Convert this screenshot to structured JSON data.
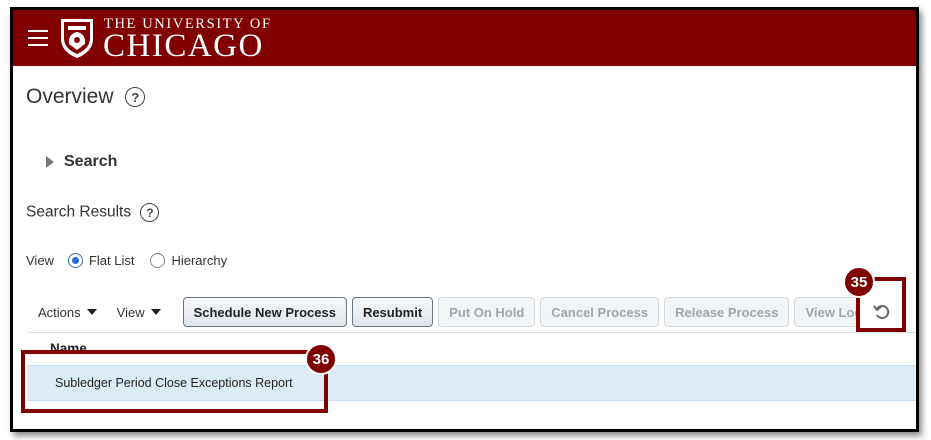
{
  "header": {
    "university_top": "THE UNIVERSITY OF",
    "university_main": "CHICAGO",
    "brand_color": "#800000"
  },
  "page": {
    "title": "Overview",
    "search_label": "Search",
    "search_results_label": "Search Results"
  },
  "view": {
    "label": "View",
    "options": [
      "Flat List",
      "Hierarchy"
    ],
    "selected": "Flat List"
  },
  "toolbar": {
    "actions_label": "Actions",
    "view_label": "View",
    "buttons": [
      {
        "label": "Schedule New Process",
        "enabled": true
      },
      {
        "label": "Resubmit",
        "enabled": true
      },
      {
        "label": "Put On Hold",
        "enabled": false
      },
      {
        "label": "Cancel Process",
        "enabled": false
      },
      {
        "label": "Release Process",
        "enabled": false
      },
      {
        "label": "View Log",
        "enabled": false
      }
    ]
  },
  "table": {
    "columns": [
      "Name"
    ],
    "rows": [
      {
        "name": "Subledger Period Close Exceptions Report"
      }
    ]
  },
  "callouts": {
    "refresh": "35",
    "row": "36"
  },
  "icons": {
    "menu": "hamburger-icon",
    "crest": "university-crest-icon",
    "help": "help-icon",
    "refresh": "refresh-icon"
  }
}
